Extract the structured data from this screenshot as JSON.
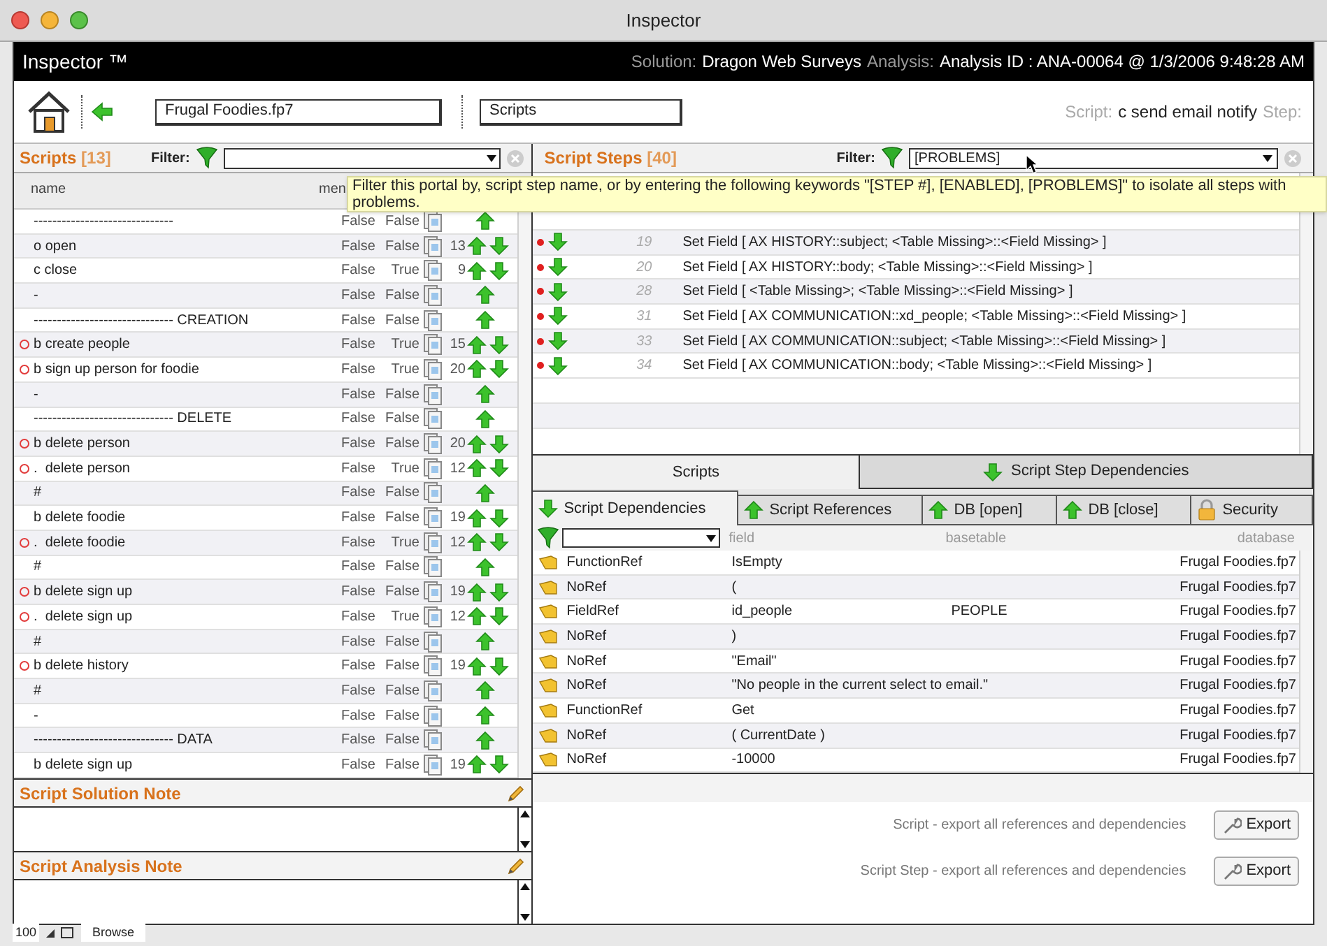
{
  "window": {
    "title": "Inspector"
  },
  "header": {
    "app_name": "Inspector ™",
    "solution_label": "Solution:",
    "solution": "Dragon Web Surveys",
    "analysis_label": "Analysis:",
    "analysis": "Analysis ID : ANA-00064 @ 1/3/2006 9:48:28 AM"
  },
  "toolbar": {
    "file": "Frugal Foodies.fp7",
    "layout": "Scripts",
    "script_label": "Script:",
    "script": "c send email notify",
    "step_label": "Step:"
  },
  "scripts_panel": {
    "title": "Scripts",
    "count": "[13]",
    "filter_label": "Filter:",
    "columns": [
      "name",
      "men"
    ],
    "rows": [
      {
        "name": "------------------------------",
        "flagged": false,
        "col_2": "False",
        "col_3": "False"
      },
      {
        "name": "o open",
        "flagged": false,
        "col_2": "False",
        "col_3": "False",
        "count": "13"
      },
      {
        "name": "c close",
        "flagged": false,
        "col_2": "False",
        "col_3": "True",
        "count": "9"
      },
      {
        "name": "-",
        "flagged": false,
        "col_2": "False",
        "col_3": "False"
      },
      {
        "name": "------------------------------ CREATION",
        "flagged": false,
        "col_2": "False",
        "col_3": "False"
      },
      {
        "name": "b create people",
        "flagged": true,
        "col_2": "False",
        "col_3": "True",
        "count": "15"
      },
      {
        "name": "b sign up person for foodie",
        "flagged": true,
        "col_2": "False",
        "col_3": "True",
        "count": "20"
      },
      {
        "name": "-",
        "flagged": false,
        "col_2": "False",
        "col_3": "False"
      },
      {
        "name": "------------------------------ DELETE",
        "flagged": false,
        "col_2": "False",
        "col_3": "False"
      },
      {
        "name": "b delete person",
        "flagged": true,
        "col_2": "False",
        "col_3": "False",
        "count": "20"
      },
      {
        "name": ".  delete person",
        "flagged": true,
        "col_2": "False",
        "col_3": "True",
        "count": "12"
      },
      {
        "name": "#",
        "flagged": false,
        "col_2": "False",
        "col_3": "False"
      },
      {
        "name": "b delete foodie",
        "flagged": false,
        "col_2": "False",
        "col_3": "False",
        "count": "19"
      },
      {
        "name": ".  delete foodie",
        "flagged": true,
        "col_2": "False",
        "col_3": "True",
        "count": "12"
      },
      {
        "name": "#",
        "flagged": false,
        "col_2": "False",
        "col_3": "False"
      },
      {
        "name": "b delete sign up",
        "flagged": true,
        "col_2": "False",
        "col_3": "False",
        "count": "19"
      },
      {
        "name": ".  delete sign up",
        "flagged": true,
        "col_2": "False",
        "col_3": "True",
        "count": "12"
      },
      {
        "name": "#",
        "flagged": false,
        "col_2": "False",
        "col_3": "False"
      },
      {
        "name": "b delete history",
        "flagged": true,
        "col_2": "False",
        "col_3": "False",
        "count": "19"
      },
      {
        "name": "#",
        "flagged": false,
        "col_2": "False",
        "col_3": "False"
      },
      {
        "name": "-",
        "flagged": false,
        "col_2": "False",
        "col_3": "False"
      },
      {
        "name": "------------------------------ DATA",
        "flagged": false,
        "col_2": "False",
        "col_3": "False"
      },
      {
        "name": "b delete sign up",
        "flagged": false,
        "col_2": "False",
        "col_3": "False",
        "count": "19"
      }
    ]
  },
  "tooltip": {
    "text": "Filter this portal by, script step name, or by entering the following keywords \"[STEP #], [ENABLED], [PROBLEMS]\" to isolate all steps with problems."
  },
  "steps_panel": {
    "title": "Script Steps",
    "count": "[40]",
    "filter_label": "Filter:",
    "filter_value": "[PROBLEMS]",
    "rows": [
      {
        "number": "19",
        "text": "Set Field [ AX HISTORY::subject; <Table Missing>::<Field Missing> ]"
      },
      {
        "number": "20",
        "text": "Set Field [ AX HISTORY::body; <Table Missing>::<Field Missing> ]"
      },
      {
        "number": "28",
        "text": "Set Field [ <Table Missing>; <Table Missing>::<Field Missing> ]"
      },
      {
        "number": "31",
        "text": "Set Field [ AX COMMUNICATION::xd_people; <Table Missing>::<Field Missing> ]"
      },
      {
        "number": "33",
        "text": "Set Field [ AX COMMUNICATION::subject; <Table Missing>::<Field Missing> ]"
      },
      {
        "number": "34",
        "text": "Set Field [ AX COMMUNICATION::body; <Table Missing>::<Field Missing> ]"
      }
    ]
  },
  "tabs": [
    {
      "label": "Scripts",
      "selected": true,
      "kind": "plain"
    },
    {
      "label": "Script Step Dependencies",
      "selected": false,
      "kind": "down"
    }
  ],
  "subtabs": [
    {
      "label": "Script Dependencies",
      "selected": true,
      "kind": "down"
    },
    {
      "label": "Script References",
      "selected": false,
      "kind": "up"
    },
    {
      "label": "DB [open]",
      "selected": false,
      "kind": "up"
    },
    {
      "label": "DB [close]",
      "selected": false,
      "kind": "up"
    },
    {
      "label": "Security",
      "selected": false,
      "kind": "lock"
    }
  ],
  "dependencies": {
    "columns": [
      "field",
      "basetable",
      "database"
    ],
    "rows": [
      {
        "type": "FunctionRef",
        "field": "IsEmpty",
        "database": "Frugal Foodies.fp7"
      },
      {
        "type": "NoRef",
        "field": "(",
        "database": "Frugal Foodies.fp7"
      },
      {
        "type": "FieldRef",
        "field": "id_people",
        "basetable": "PEOPLE",
        "database": "Frugal Foodies.fp7"
      },
      {
        "type": "NoRef",
        "field": ")",
        "database": "Frugal Foodies.fp7"
      },
      {
        "type": "NoRef",
        "field": "\"Email\"",
        "database": "Frugal Foodies.fp7"
      },
      {
        "type": "NoRef",
        "field": "\"No people in the current select to email.\"",
        "database": "Frugal Foodies.fp7"
      },
      {
        "type": "FunctionRef",
        "field": "Get",
        "database": "Frugal Foodies.fp7"
      },
      {
        "type": "NoRef",
        "field": "( CurrentDate )",
        "database": "Frugal Foodies.fp7"
      },
      {
        "type": "NoRef",
        "field": "-10000",
        "database": "Frugal Foodies.fp7"
      }
    ]
  },
  "notes": [
    {
      "title": "Script Solution Note"
    },
    {
      "title": "Script Analysis Note"
    }
  ],
  "exports": [
    {
      "label": "Script - export all references and dependencies",
      "button": "Export"
    },
    {
      "label": "Script Step - export all references and dependencies",
      "button": "Export"
    }
  ],
  "status_bar": {
    "zoom": "100",
    "mode": "Browse"
  }
}
